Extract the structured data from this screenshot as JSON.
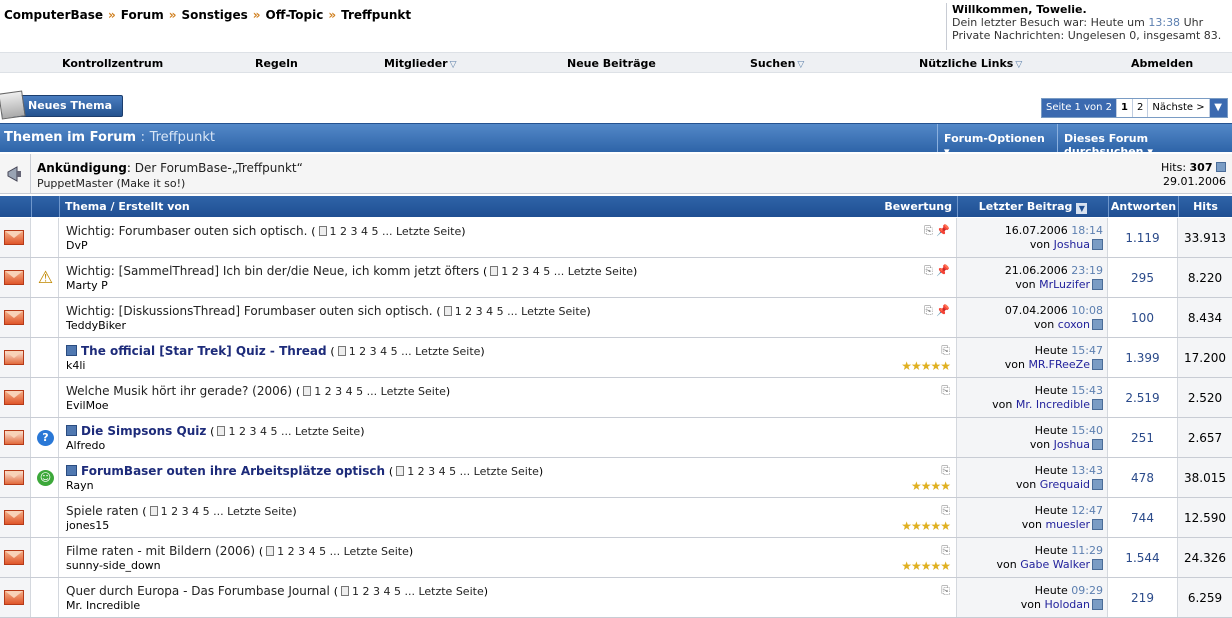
{
  "breadcrumb": [
    "ComputerBase",
    "Forum",
    "Sonstiges",
    "Off-Topic",
    "Treffpunkt"
  ],
  "breadcrumb_sep": "»",
  "welcome": {
    "greeting": "Willkommen, Towelie.",
    "last_visit_prefix": "Dein letzter Besuch war: Heute um",
    "last_visit_time": "13:38",
    "last_visit_suffix": "Uhr",
    "messages": "Private Nachrichten: Ungelesen 0, insgesamt 83."
  },
  "nav": [
    {
      "label": "Kontrollzentrum",
      "dropdown": false
    },
    {
      "label": "Regeln",
      "dropdown": false
    },
    {
      "label": "Mitglieder",
      "dropdown": true
    },
    {
      "label": "Neue Beiträge",
      "dropdown": false
    },
    {
      "label": "Suchen",
      "dropdown": true
    },
    {
      "label": "Nützliche Links",
      "dropdown": true
    },
    {
      "label": "Abmelden",
      "dropdown": false
    }
  ],
  "new_thread_label": "Neues Thema",
  "pager": {
    "info": "Seite 1 von 2",
    "pages": [
      "1",
      "2"
    ],
    "next": "Nächste >"
  },
  "forumbar": {
    "prefix": "Themen im Forum",
    "name": "Treffpunkt",
    "options": "Forum-Optionen",
    "search": "Dieses Forum durchsuchen"
  },
  "announcement": {
    "label": "Ankündigung",
    "title": "Der ForumBase-„Treffpunkt“",
    "author": "PuppetMaster (Make it so!)",
    "hits_label": "Hits:",
    "hits": "307",
    "date": "29.01.2006"
  },
  "table_header": {
    "thread": "Thema / Erstellt von",
    "rating": "Bewertung",
    "last_post": "Letzter Beitrag",
    "replies": "Antworten",
    "hits": "Hits"
  },
  "page_links": {
    "pages": "1 2 3 4 5 ...",
    "last": "Letzte Seite"
  },
  "threads": [
    {
      "title": "Wichtig: Forumbaser outen sich optisch.",
      "bold": false,
      "check": false,
      "author": "DvP",
      "status_icon": "",
      "clip": true,
      "pin": true,
      "stars": 0,
      "date": "16.07.2006",
      "time": "18:14",
      "by": "Joshua",
      "replies": "1.119",
      "hits": "33.913"
    },
    {
      "title": "Wichtig: [SammelThread] Ich bin der/die Neue, ich komm jetzt öfters",
      "bold": false,
      "check": false,
      "author": "Marty P",
      "status_icon": "warning-icon",
      "clip": true,
      "pin": true,
      "stars": 0,
      "date": "21.06.2006",
      "time": "23:19",
      "by": "MrLuzifer",
      "replies": "295",
      "hits": "8.220"
    },
    {
      "title": "Wichtig: [DiskussionsThread] Forumbaser outen sich optisch.",
      "bold": false,
      "check": false,
      "author": "TeddyBiker",
      "status_icon": "",
      "clip": true,
      "pin": true,
      "stars": 0,
      "date": "07.04.2006",
      "time": "10:08",
      "by": "coxon",
      "replies": "100",
      "hits": "8.434"
    },
    {
      "title": "The official [Star Trek] Quiz - Thread",
      "bold": true,
      "check": true,
      "author": "k4li",
      "status_icon": "",
      "clip": true,
      "pin": false,
      "stars": 5,
      "date": "Heute",
      "time": "15:47",
      "by": "MR.FReeZe",
      "replies": "1.399",
      "hits": "17.200"
    },
    {
      "title": "Welche Musik hört ihr gerade? (2006)",
      "bold": false,
      "check": false,
      "author": "EvilMoe",
      "status_icon": "",
      "clip": true,
      "pin": false,
      "stars": 0,
      "date": "Heute",
      "time": "15:43",
      "by": "Mr. Incredible",
      "replies": "2.519",
      "hits": "2.520"
    },
    {
      "title": "Die Simpsons Quiz",
      "bold": true,
      "check": true,
      "author": "Alfredo",
      "status_icon": "question-icon",
      "clip": false,
      "pin": false,
      "stars": 0,
      "date": "Heute",
      "time": "15:40",
      "by": "Joshua",
      "replies": "251",
      "hits": "2.657"
    },
    {
      "title": "ForumBaser outen ihre Arbeitsplätze optisch",
      "bold": true,
      "check": true,
      "author": "Rayn",
      "status_icon": "grin-icon",
      "clip": true,
      "pin": false,
      "stars": 4,
      "date": "Heute",
      "time": "13:43",
      "by": "Grequaid",
      "replies": "478",
      "hits": "38.015"
    },
    {
      "title": "Spiele raten",
      "bold": false,
      "check": false,
      "author": "jones15",
      "status_icon": "",
      "clip": true,
      "pin": false,
      "stars": 5,
      "date": "Heute",
      "time": "12:47",
      "by": "muesler",
      "replies": "744",
      "hits": "12.590"
    },
    {
      "title": "Filme raten - mit Bildern (2006)",
      "bold": false,
      "check": false,
      "author": "sunny-side_down",
      "status_icon": "",
      "clip": true,
      "pin": false,
      "stars": 5,
      "date": "Heute",
      "time": "11:29",
      "by": "Gabe Walker",
      "replies": "1.544",
      "hits": "24.326"
    },
    {
      "title": "Quer durch Europa - Das Forumbase Journal",
      "bold": false,
      "check": false,
      "author": "Mr. Incredible",
      "status_icon": "",
      "clip": true,
      "pin": false,
      "stars": 0,
      "date": "Heute",
      "time": "09:29",
      "by": "Holodan",
      "replies": "219",
      "hits": "6.259"
    }
  ],
  "by_prefix": "von",
  "colors": {
    "accent": "#2f63a8",
    "time": "#5c7fb0",
    "link": "#22229c"
  }
}
